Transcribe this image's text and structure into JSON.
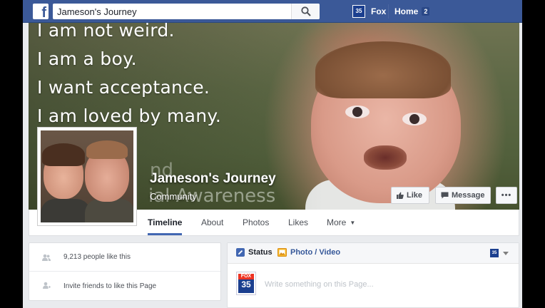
{
  "topbar": {
    "search_value": "Jameson's Journey",
    "user_name": "Fox",
    "user_avatar_text": "35",
    "home_label": "Home",
    "home_badge": "2"
  },
  "cover": {
    "lines": [
      "I am not weird.",
      "I am a boy.",
      "I want acceptance.",
      "I am loved by many."
    ],
    "faded_top": "nd",
    "faded_bottom": "ial Awareness"
  },
  "page": {
    "name": "Jameson's Journey",
    "category": "Community",
    "buttons": {
      "like": "Like",
      "message": "Message",
      "more": "•••"
    }
  },
  "tabs": [
    {
      "label": "Timeline",
      "active": true
    },
    {
      "label": "About"
    },
    {
      "label": "Photos"
    },
    {
      "label": "Likes"
    },
    {
      "label": "More"
    }
  ],
  "sidebar": {
    "likes_text": "9,213 people like this",
    "invite_text": "Invite friends to like this Page"
  },
  "composer": {
    "tab_status": "Status",
    "tab_photo": "Photo / Video",
    "selector_avatar_text": "35",
    "avatar_top": "FOX",
    "avatar_number": "35",
    "placeholder": "Write something on this Page..."
  },
  "colors": {
    "brand": "#3b5998",
    "link": "#365899",
    "active_tab_border": "#4267b2"
  }
}
